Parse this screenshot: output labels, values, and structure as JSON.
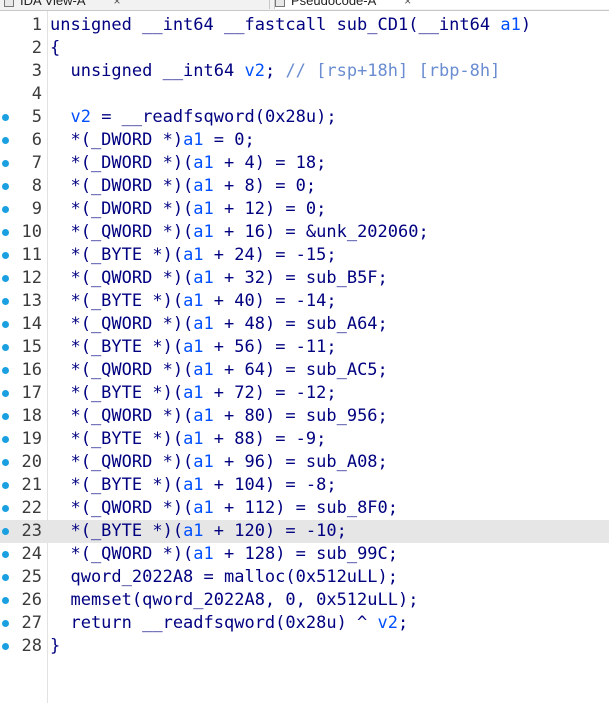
{
  "tabs": [
    {
      "label": "IDA View-A",
      "close": "×"
    },
    {
      "label": "Pseudocode-A",
      "close": "×"
    }
  ],
  "code": {
    "current_line": 23,
    "lines": [
      {
        "n": "1",
        "bp": false,
        "text": "unsigned __int64 __fastcall sub_CD1(__int64 a1)"
      },
      {
        "n": "2",
        "bp": false,
        "text": "{"
      },
      {
        "n": "3",
        "bp": false,
        "text": "  unsigned __int64 v2; // [rsp+18h] [rbp-8h]"
      },
      {
        "n": "4",
        "bp": false,
        "text": ""
      },
      {
        "n": "5",
        "bp": true,
        "text": "  v2 = __readfsqword(0x28u);"
      },
      {
        "n": "6",
        "bp": true,
        "text": "  *(_DWORD *)a1 = 0;"
      },
      {
        "n": "7",
        "bp": true,
        "text": "  *(_DWORD *)(a1 + 4) = 18;"
      },
      {
        "n": "8",
        "bp": true,
        "text": "  *(_DWORD *)(a1 + 8) = 0;"
      },
      {
        "n": "9",
        "bp": true,
        "text": "  *(_DWORD *)(a1 + 12) = 0;"
      },
      {
        "n": "10",
        "bp": true,
        "text": "  *(_QWORD *)(a1 + 16) = &unk_202060;"
      },
      {
        "n": "11",
        "bp": true,
        "text": "  *(_BYTE *)(a1 + 24) = -15;"
      },
      {
        "n": "12",
        "bp": true,
        "text": "  *(_QWORD *)(a1 + 32) = sub_B5F;"
      },
      {
        "n": "13",
        "bp": true,
        "text": "  *(_BYTE *)(a1 + 40) = -14;"
      },
      {
        "n": "14",
        "bp": true,
        "text": "  *(_QWORD *)(a1 + 48) = sub_A64;"
      },
      {
        "n": "15",
        "bp": true,
        "text": "  *(_BYTE *)(a1 + 56) = -11;"
      },
      {
        "n": "16",
        "bp": true,
        "text": "  *(_QWORD *)(a1 + 64) = sub_AC5;"
      },
      {
        "n": "17",
        "bp": true,
        "text": "  *(_BYTE *)(a1 + 72) = -12;"
      },
      {
        "n": "18",
        "bp": true,
        "text": "  *(_QWORD *)(a1 + 80) = sub_956;"
      },
      {
        "n": "19",
        "bp": true,
        "text": "  *(_BYTE *)(a1 + 88) = -9;"
      },
      {
        "n": "20",
        "bp": true,
        "text": "  *(_QWORD *)(a1 + 96) = sub_A08;"
      },
      {
        "n": "21",
        "bp": true,
        "text": "  *(_BYTE *)(a1 + 104) = -8;"
      },
      {
        "n": "22",
        "bp": true,
        "text": "  *(_QWORD *)(a1 + 112) = sub_8F0;"
      },
      {
        "n": "23",
        "bp": true,
        "text": "  *(_BYTE *)(a1 + 120) = -10;"
      },
      {
        "n": "24",
        "bp": true,
        "text": "  *(_QWORD *)(a1 + 128) = sub_99C;"
      },
      {
        "n": "25",
        "bp": true,
        "text": "  qword_2022A8 = malloc(0x512uLL);"
      },
      {
        "n": "26",
        "bp": true,
        "text": "  memset(qword_2022A8, 0, 0x512uLL);"
      },
      {
        "n": "27",
        "bp": true,
        "text": "  return __readfsqword(0x28u) ^ v2;"
      },
      {
        "n": "28",
        "bp": true,
        "text": "}"
      }
    ]
  },
  "colors": {
    "code_text": "#000080",
    "local_var": "#0050ff",
    "comment": "#6a8cd0",
    "breakpoint_dot": "#1aa0e0",
    "current_line_bg": "#e6e6e6"
  }
}
